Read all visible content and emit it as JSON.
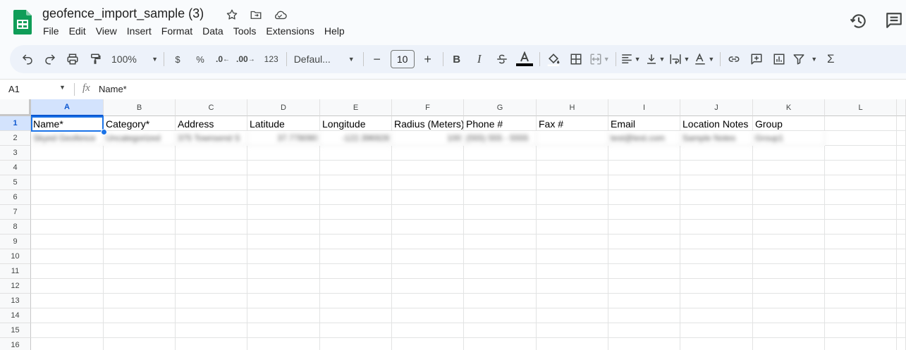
{
  "document": {
    "title": "geofence_import_sample (3)"
  },
  "menu": [
    "File",
    "Edit",
    "View",
    "Insert",
    "Format",
    "Data",
    "Tools",
    "Extensions",
    "Help"
  ],
  "toolbar": {
    "zoom": "100%",
    "currency": "$",
    "percent": "%",
    "dec_decrease": ".0",
    "dec_increase": ".00",
    "number_format": "123",
    "font": "Defaul...",
    "font_size": "10"
  },
  "namebox": "A1",
  "formula": "Name*",
  "columns": [
    "A",
    "B",
    "C",
    "D",
    "E",
    "F",
    "G",
    "H",
    "I",
    "J",
    "K",
    "L"
  ],
  "rows": [
    "1",
    "2",
    "3",
    "4",
    "5",
    "6",
    "7",
    "8",
    "9",
    "10",
    "11",
    "12",
    "13",
    "14",
    "15",
    "16"
  ],
  "header_row": [
    "Name*",
    "Category*",
    "Address",
    "Latitude",
    "Longitude",
    "Radius (Meters)",
    "Phone #",
    "Fax #",
    "Email",
    "Location Notes",
    "Group"
  ],
  "data_row": [
    "Skyed Geofence",
    "Uncategorized",
    "375 Townsend S",
    "37.778090",
    "-122.396928",
    "100",
    "(555) 555 - 5555",
    "",
    "test@test.com",
    "Sample Notes",
    "Group1"
  ]
}
